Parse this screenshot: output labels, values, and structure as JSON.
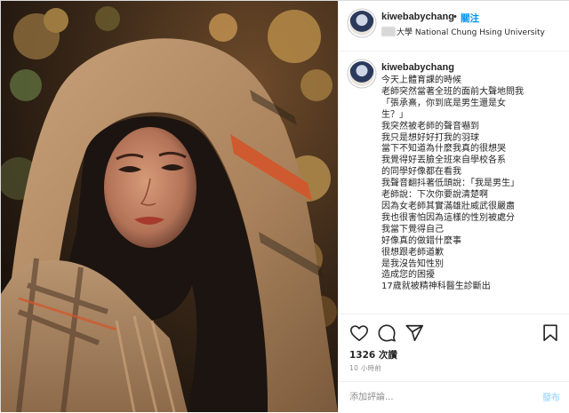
{
  "post": {
    "photo_alt": "portrait",
    "username": "kiwebabychang",
    "follow_label": "關注",
    "location": "大學 National Chung Hsing University",
    "caption_username": "kiwebabychang",
    "caption_lines": [
      "今天上體育課的時候",
      "老師突然當著全班的面前大聲地問我",
      "「張承熹，你到底是男生還是女",
      "生？」",
      "我突然被老師的聲音嚇到",
      "我只是想好好打我的羽球",
      "當下不知道為什麼我真的很想哭",
      "我覺得好丟臉全班來自學校各系",
      "的同學好像都在看我",
      "我聲音翻抖著低頭說：「我是男生」",
      "老師說：下次你要說清楚啊",
      "因為女老師其實滿雄壯威武很嚴肅",
      "我也很害怕因為這樣的性別被處分",
      "我當下覺得自己",
      "好像真的做錯什麼事",
      "很想跟老師道歉",
      "是我沒告知性別",
      "造成您的困擾",
      "17歲就被精神科醫生診斷出"
    ],
    "likes": "1326 次讚",
    "time": "10 小時前",
    "comment_placeholder": "添加評論...",
    "post_label": "發布"
  },
  "icons": {
    "like": "heart-icon",
    "comment": "comment-icon",
    "share": "paper-plane-icon",
    "save": "bookmark-icon"
  },
  "colors": {
    "accent": "#0095f6",
    "post_disabled": "#b2dffc",
    "text": "#262626",
    "muted": "#8e8e8e",
    "border": "#efefef"
  }
}
